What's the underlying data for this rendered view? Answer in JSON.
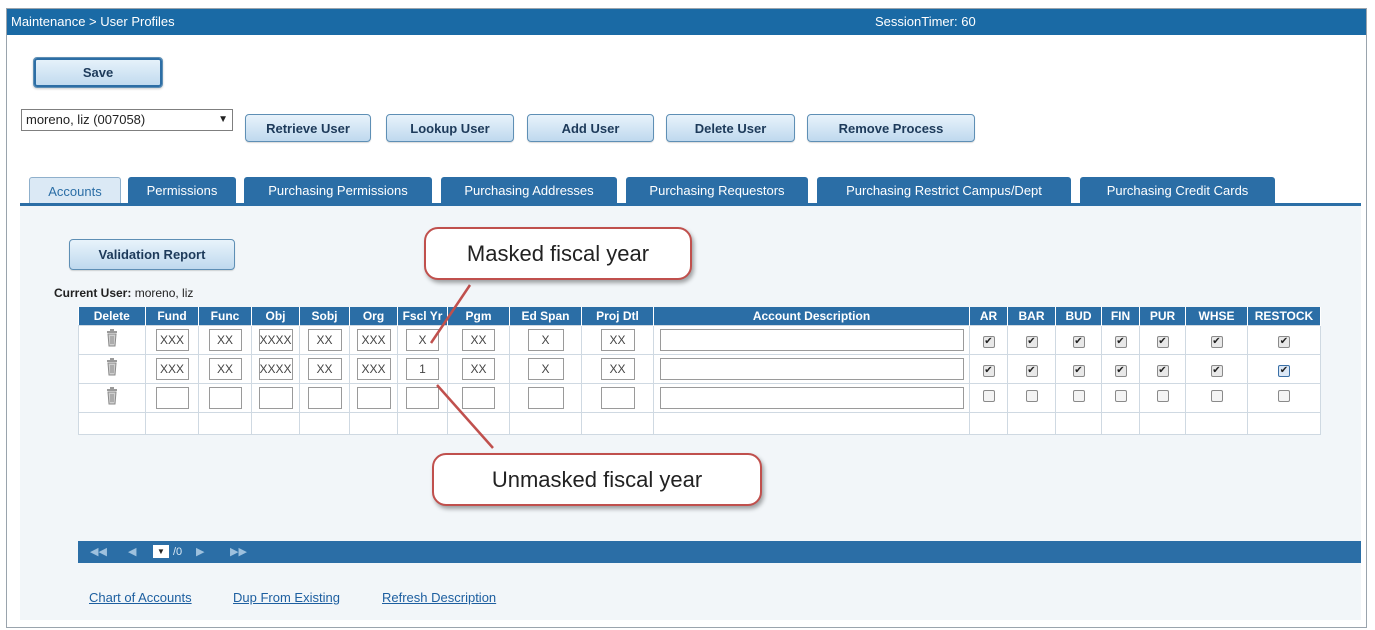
{
  "header": {
    "breadcrumb": "Maintenance > User Profiles",
    "session_timer": "SessionTimer: 60"
  },
  "toolbar": {
    "save": "Save",
    "user_select_value": "moreno, liz (007058)",
    "retrieve_user": "Retrieve User",
    "lookup_user": "Lookup User",
    "add_user": "Add User",
    "delete_user": "Delete User",
    "remove_process": "Remove Process"
  },
  "tabs": [
    {
      "label": "Accounts",
      "active": true
    },
    {
      "label": "Permissions"
    },
    {
      "label": "Purchasing Permissions"
    },
    {
      "label": "Purchasing Addresses"
    },
    {
      "label": "Purchasing Requestors"
    },
    {
      "label": "Purchasing Restrict Campus/Dept"
    },
    {
      "label": "Purchasing Credit Cards"
    }
  ],
  "accounts": {
    "validation_report": "Validation Report",
    "current_user_label": "Current User:",
    "current_user_value": "moreno, liz",
    "columns": [
      "Delete",
      "Fund",
      "Func",
      "Obj",
      "Sobj",
      "Org",
      "Fscl Yr",
      "Pgm",
      "Ed Span",
      "Proj Dtl",
      "Account Description",
      "AR",
      "BAR",
      "BUD",
      "FIN",
      "PUR",
      "WHSE",
      "RESTOCK"
    ],
    "rows": [
      {
        "fund": "XXX",
        "func": "XX",
        "obj": "XXXX",
        "sobj": "XX",
        "org": "XXX",
        "fscl": "X",
        "pgm": "XX",
        "edspan": "X",
        "proj": "XX",
        "desc": "",
        "checks": [
          true,
          true,
          true,
          true,
          true,
          true,
          true
        ]
      },
      {
        "fund": "XXX",
        "func": "XX",
        "obj": "XXXX",
        "sobj": "XX",
        "org": "XXX",
        "fscl": "1",
        "pgm": "XX",
        "edspan": "X",
        "proj": "XX",
        "desc": "",
        "checks": [
          true,
          true,
          true,
          true,
          true,
          true,
          true
        ]
      },
      {
        "fund": "",
        "func": "",
        "obj": "",
        "sobj": "",
        "org": "",
        "fscl": "",
        "pgm": "",
        "edspan": "",
        "proj": "",
        "desc": "",
        "checks": [
          false,
          false,
          false,
          false,
          false,
          false,
          false
        ]
      }
    ]
  },
  "pager": {
    "first": "◀◀",
    "prev": "◀",
    "page_value": "▼",
    "page_total": "/0",
    "next": "▶",
    "last": "▶▶"
  },
  "links": {
    "chart_of_accounts": "Chart of Accounts",
    "dup_from_existing": "Dup From Existing",
    "refresh_description": "Refresh Description"
  },
  "annotations": {
    "masked": "Masked fiscal year",
    "unmasked": "Unmasked fiscal year",
    "color": "#c0504d"
  }
}
